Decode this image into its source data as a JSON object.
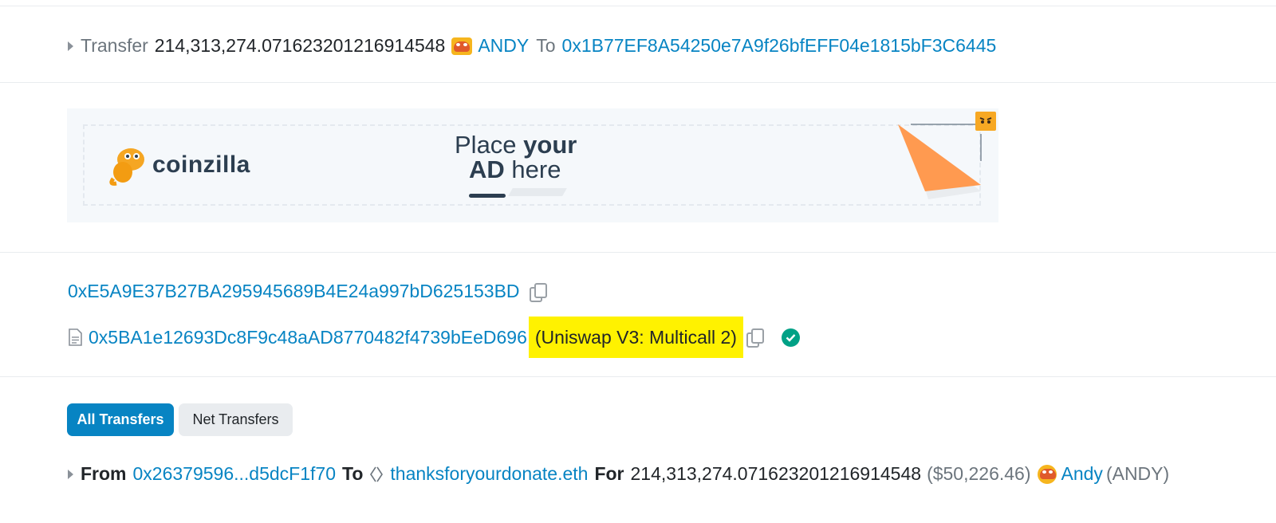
{
  "transfer_row": {
    "action": "Transfer",
    "amount": "214,313,274.071623201216914548",
    "token_symbol": "ANDY",
    "to_label": "To",
    "to_address": "0x1B77EF8A54250e7A9f26bfEFF04e1815bF3C6445"
  },
  "ad": {
    "brand": "coinzilla",
    "headline_line1_regular": "Place ",
    "headline_line1_bold": "your",
    "headline_line2_bold": "AD",
    "headline_line2_regular": " here"
  },
  "addresses": {
    "address1": "0xE5A9E37B27BA295945689B4E24a997bD625153BD",
    "contract_address": "0x5BA1e12693Dc8F9c48aAD8770482f4739bEeD696",
    "contract_name": "(Uniswap V3: Multicall 2)"
  },
  "tabs": {
    "all": "All Transfers",
    "net": "Net Transfers"
  },
  "from_row": {
    "from_label": "From",
    "from_address": "0x26379596...d5dcF1f70",
    "to_label": "To",
    "to_name": "thanksforyourdonate.eth",
    "for_label": "For",
    "amount": "214,313,274.071623201216914548",
    "usd_value": "($50,226.46)",
    "token_name": "Andy",
    "token_symbol": "(ANDY)"
  },
  "colors": {
    "link": "#0784c3",
    "highlight": "#fff200",
    "primary_button": "#0784c3",
    "success": "#00a186"
  },
  "icons": [
    "caret-right-icon",
    "andy-token-icon",
    "copy-icon",
    "contract-file-icon",
    "verified-check-icon",
    "ens-icon"
  ]
}
